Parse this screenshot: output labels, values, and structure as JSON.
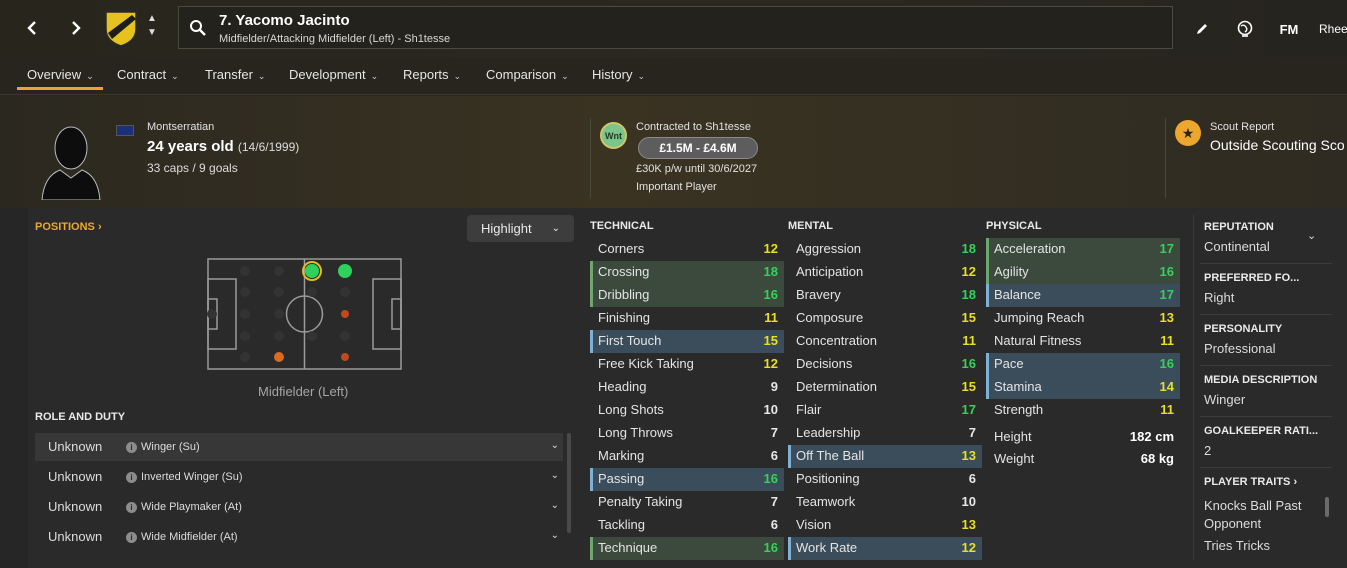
{
  "header": {
    "player_title": "7. Yacomo Jacinto",
    "player_subtitle": "Midfielder/Attacking Midfielder (Left) - Sh1tesse",
    "fm_label": "FM",
    "user_label": "Rhee"
  },
  "tabs": [
    {
      "label": "Overview"
    },
    {
      "label": "Contract"
    },
    {
      "label": "Transfer"
    },
    {
      "label": "Development"
    },
    {
      "label": "Reports"
    },
    {
      "label": "Comparison"
    },
    {
      "label": "History"
    }
  ],
  "profile": {
    "nationality": "Montserratian",
    "age": "24 years old",
    "dob": "(14/6/1999)",
    "caps": "33 caps / 9 goals"
  },
  "contract": {
    "badge": "Wnt",
    "title": "Contracted to Sh1tesse",
    "value": "£1.5M - £4.6M",
    "wage": "£30K p/w until 30/6/2027",
    "status": "Important Player"
  },
  "scout": {
    "title": "Scout Report",
    "value": "Outside Scouting Sco"
  },
  "positions": {
    "header": "POSITIONS",
    "highlight_label": "Highlight",
    "position_label": "Midfielder (Left)"
  },
  "roles": {
    "header": "ROLE AND DUTY",
    "items": [
      {
        "duty": "Unknown",
        "role": "Winger (Su)"
      },
      {
        "duty": "Unknown",
        "role": "Inverted Winger (Su)"
      },
      {
        "duty": "Unknown",
        "role": "Wide Playmaker (At)"
      },
      {
        "duty": "Unknown",
        "role": "Wide Midfielder (At)"
      }
    ]
  },
  "attributes": {
    "technical_header": "TECHNICAL",
    "mental_header": "MENTAL",
    "physical_header": "PHYSICAL",
    "technical": [
      {
        "name": "Corners",
        "value": "12"
      },
      {
        "name": "Crossing",
        "value": "18"
      },
      {
        "name": "Dribbling",
        "value": "16"
      },
      {
        "name": "Finishing",
        "value": "11"
      },
      {
        "name": "First Touch",
        "value": "15"
      },
      {
        "name": "Free Kick Taking",
        "value": "12"
      },
      {
        "name": "Heading",
        "value": "9"
      },
      {
        "name": "Long Shots",
        "value": "10"
      },
      {
        "name": "Long Throws",
        "value": "7"
      },
      {
        "name": "Marking",
        "value": "6"
      },
      {
        "name": "Passing",
        "value": "16"
      },
      {
        "name": "Penalty Taking",
        "value": "7"
      },
      {
        "name": "Tackling",
        "value": "6"
      },
      {
        "name": "Technique",
        "value": "16"
      }
    ],
    "mental": [
      {
        "name": "Aggression",
        "value": "18"
      },
      {
        "name": "Anticipation",
        "value": "12"
      },
      {
        "name": "Bravery",
        "value": "18"
      },
      {
        "name": "Composure",
        "value": "15"
      },
      {
        "name": "Concentration",
        "value": "11"
      },
      {
        "name": "Decisions",
        "value": "16"
      },
      {
        "name": "Determination",
        "value": "15"
      },
      {
        "name": "Flair",
        "value": "17"
      },
      {
        "name": "Leadership",
        "value": "7"
      },
      {
        "name": "Off The Ball",
        "value": "13"
      },
      {
        "name": "Positioning",
        "value": "6"
      },
      {
        "name": "Teamwork",
        "value": "10"
      },
      {
        "name": "Vision",
        "value": "13"
      },
      {
        "name": "Work Rate",
        "value": "12"
      }
    ],
    "physical": [
      {
        "name": "Acceleration",
        "value": "17"
      },
      {
        "name": "Agility",
        "value": "16"
      },
      {
        "name": "Balance",
        "value": "17"
      },
      {
        "name": "Jumping Reach",
        "value": "13"
      },
      {
        "name": "Natural Fitness",
        "value": "11"
      },
      {
        "name": "Pace",
        "value": "16"
      },
      {
        "name": "Stamina",
        "value": "14"
      },
      {
        "name": "Strength",
        "value": "11"
      }
    ],
    "height_label": "Height",
    "height": "182 cm",
    "weight_label": "Weight",
    "weight": "68 kg"
  },
  "side_panel": {
    "reputation_title": "REPUTATION",
    "reputation": "Continental",
    "foot_title": "PREFERRED FO...",
    "foot": "Right",
    "personality_title": "PERSONALITY",
    "personality": "Professional",
    "media_title": "MEDIA DESCRIPTION",
    "media": "Winger",
    "gk_title": "GOALKEEPER RATI...",
    "gk": "2",
    "traits_title": "PLAYER TRAITS",
    "trait_1a": "Knocks Ball Past",
    "trait_1b": "Opponent",
    "trait_2": "Tries Tricks"
  },
  "colors": {
    "accent": "#eda72f",
    "attr_high": "#37d05b",
    "attr_mid": "#e8df28",
    "highlight_blue": "#3b4d5a",
    "highlight_green": "#3b4a3d"
  }
}
